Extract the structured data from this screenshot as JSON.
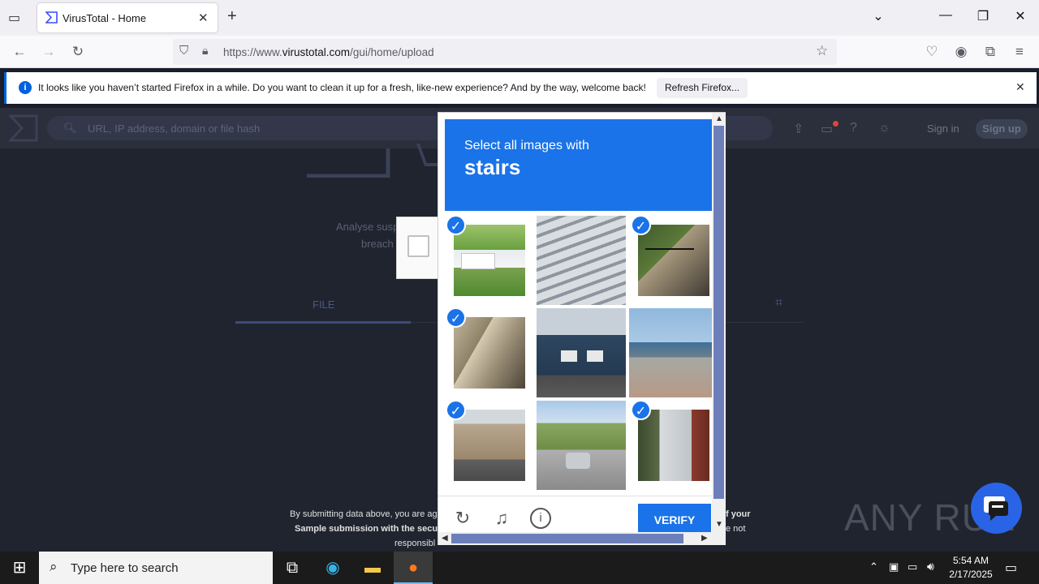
{
  "browser": {
    "tab_title": "VirusTotal - Home",
    "url_prefix": "https://www.",
    "url_domain": "virustotal.com",
    "url_path": "/gui/home/upload"
  },
  "notification": {
    "message": "It looks like you haven’t started Firefox in a while. Do you want to clean it up for a fresh, like-new experience? And by the way, welcome back!",
    "button": "Refresh Firefox..."
  },
  "vt": {
    "search_placeholder": "URL, IP address, domain or file hash",
    "sign_in": "Sign in",
    "sign_up": "Sign up",
    "intro_line1": "Analyse susp",
    "intro_line2": "breach",
    "file_tab": "FILE",
    "footer_line1": "By submitting data above, you are ag",
    "footer_line2": "Sample submission with the secu",
    "footer_line3": "responsibl",
    "footer_right1": "f your",
    "footer_right2": "e not"
  },
  "captcha": {
    "prompt": "Select all images with",
    "target": "stairs",
    "verify_label": "VERIFY",
    "tiles": [
      {
        "name": "house-with-lawn",
        "selected": true
      },
      {
        "name": "overpass-underside",
        "selected": false
      },
      {
        "name": "outdoor-stairs-railing",
        "selected": true
      },
      {
        "name": "stone-stairs",
        "selected": true
      },
      {
        "name": "blue-house",
        "selected": false
      },
      {
        "name": "parking-lot-ramp",
        "selected": false
      },
      {
        "name": "apartment-building",
        "selected": true
      },
      {
        "name": "street-with-cars",
        "selected": false
      },
      {
        "name": "metal-stairs-building",
        "selected": true
      }
    ]
  },
  "watermark": "ANY RUN",
  "taskbar": {
    "search_placeholder": "Type here to search",
    "time": "5:54 AM",
    "date": "2/17/2025"
  }
}
